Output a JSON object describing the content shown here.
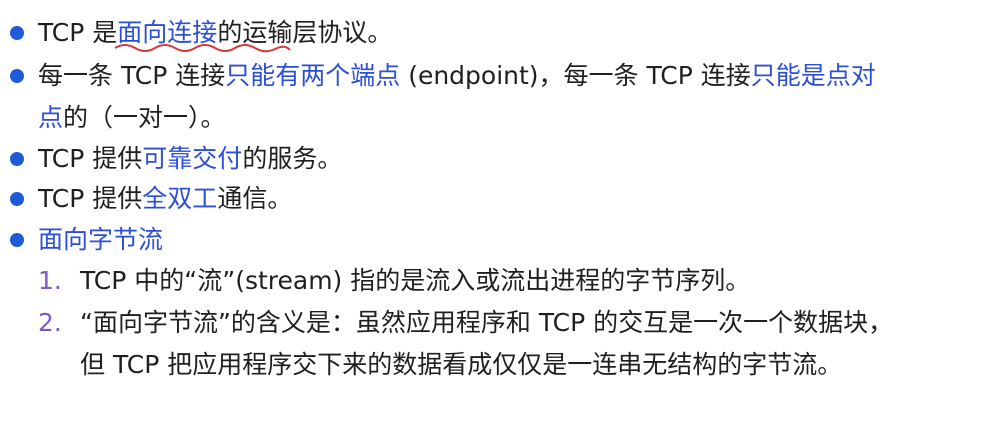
{
  "colors": {
    "bullet": "#1f5ad8",
    "highlight": "#2b4fd6",
    "number": "#7c5cc4",
    "underline": "#d33a3a"
  },
  "bullets": [
    {
      "parts": [
        "TCP 是",
        "面向连接",
        "的运输层协议。"
      ]
    },
    {
      "line1": [
        "每一条 TCP 连接",
        "只能有两个端点",
        " (endpoint)，每一条 TCP 连接",
        "只能是点对"
      ],
      "line2": [
        "点",
        "的（一对一）。"
      ]
    },
    {
      "parts": [
        "TCP 提供",
        "可靠交付",
        "的服务。"
      ]
    },
    {
      "parts": [
        "TCP 提供",
        "全双工",
        "通信。"
      ]
    },
    {
      "title": "面向字节流"
    }
  ],
  "subitems": [
    {
      "number": "1.",
      "text": "TCP 中的“流”(stream) 指的是流入或流出进程的字节序列。"
    },
    {
      "number": "2.",
      "line1": "“面向字节流”的含义是：虽然应用程序和 TCP 的交互是一次一个数据块，",
      "line2": "但 TCP 把应用程序交下来的数据看成仅仅是一连串无结构的字节流。"
    }
  ]
}
